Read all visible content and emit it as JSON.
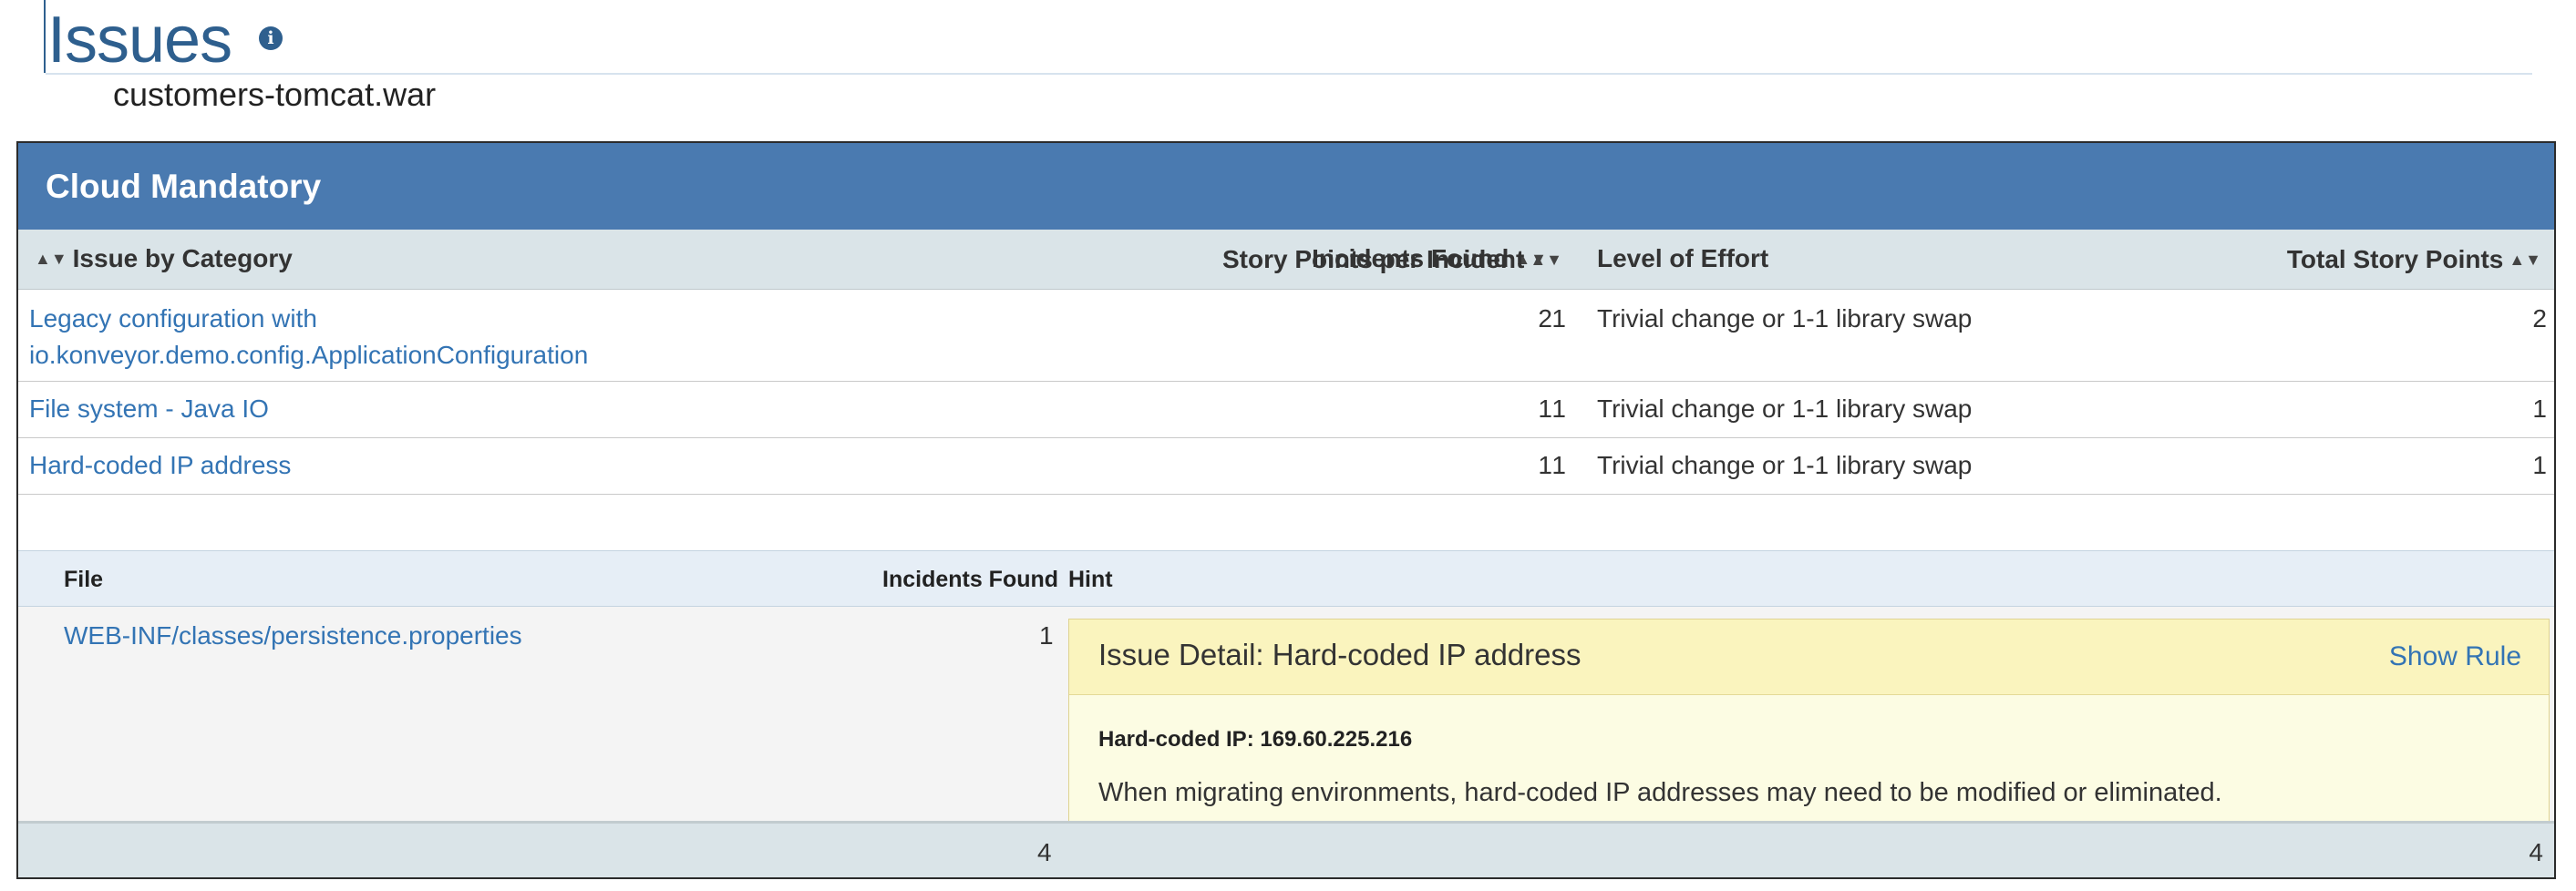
{
  "page": {
    "title": "Issues",
    "info_icon": "info-icon",
    "subtitle": "customers-tomcat.war"
  },
  "panel": {
    "heading": "Cloud Mandatory",
    "columns": {
      "category": "Issue by Category",
      "incidents": "Incidents Found",
      "points_per_incident": "Story Points per Incident",
      "effort": "Level of Effort",
      "total": "Total Story Points"
    },
    "rows": [
      {
        "issue_line1": "Legacy configuration with",
        "issue_line2": "io.konveyor.demo.config.ApplicationConfiguration",
        "incidents": "2",
        "points_per_incident": "1",
        "effort": "Trivial change or 1-1 library swap",
        "total": "2"
      },
      {
        "issue": "File system - Java IO",
        "incidents": "1",
        "points_per_incident": "1",
        "effort": "Trivial change or 1-1 library swap",
        "total": "1"
      },
      {
        "issue": "Hard-coded IP address",
        "incidents": "1",
        "points_per_incident": "1",
        "effort": "Trivial change or 1-1 library swap",
        "total": "1"
      }
    ],
    "detail": {
      "columns": {
        "file": "File",
        "incidents": "Incidents Found",
        "hint": "Hint"
      },
      "file": "WEB-INF/classes/persistence.properties",
      "incidents": "1",
      "hint": {
        "title": "Issue Detail: Hard-coded IP address",
        "show_rule": "Show Rule",
        "strong": "Hard-coded IP: 169.60.225.216",
        "text": "When migrating environments, hard-coded IP addresses may need to be modified or eliminated."
      }
    },
    "footer": {
      "incidents_total": "4",
      "story_points_total": "4"
    }
  },
  "colors": {
    "brand_blue": "#2e5f8e",
    "panel_heading_bg": "#4a7ab0",
    "link": "#3374b4",
    "table_header_bg": "#dae4e8",
    "hint_bg": "#fcfce3",
    "hint_title_bg": "#faf4be"
  }
}
